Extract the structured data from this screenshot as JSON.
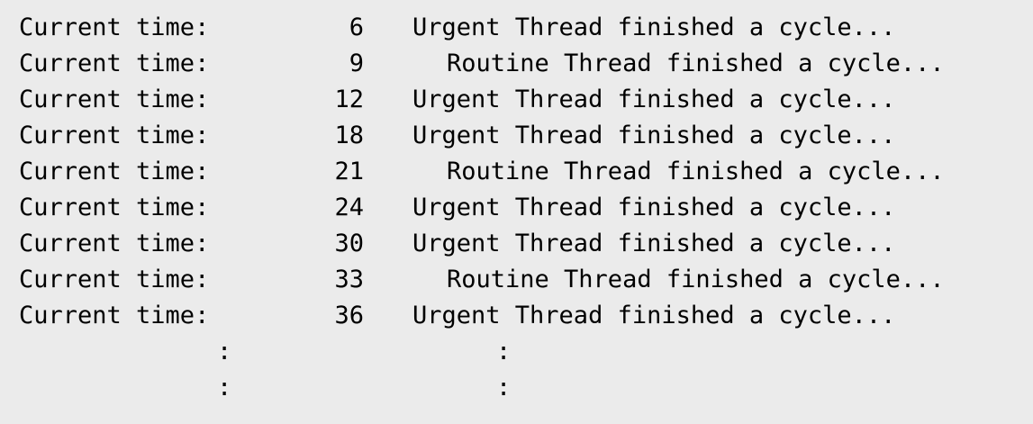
{
  "colors": {
    "background": "#ebebeb",
    "text": "#000000"
  },
  "lines": [
    {
      "label": "Current time:",
      "time": "6",
      "message": "Urgent Thread finished a cycle...",
      "kind": "urgent"
    },
    {
      "label": "Current time:",
      "time": "9",
      "message": "Routine Thread finished a cycle...",
      "kind": "routine"
    },
    {
      "label": "Current time:",
      "time": "12",
      "message": "Urgent Thread finished a cycle...",
      "kind": "urgent"
    },
    {
      "label": "Current time:",
      "time": "18",
      "message": "Urgent Thread finished a cycle...",
      "kind": "urgent"
    },
    {
      "label": "Current time:",
      "time": "21",
      "message": "Routine Thread finished a cycle...",
      "kind": "routine"
    },
    {
      "label": "Current time:",
      "time": "24",
      "message": "Urgent Thread finished a cycle...",
      "kind": "urgent"
    },
    {
      "label": "Current time:",
      "time": "30",
      "message": "Urgent Thread finished a cycle...",
      "kind": "urgent"
    },
    {
      "label": "Current time:",
      "time": "33",
      "message": "Routine Thread finished a cycle...",
      "kind": "routine"
    },
    {
      "label": "Current time:",
      "time": "36",
      "message": "Urgent Thread finished a cycle...",
      "kind": "urgent"
    }
  ],
  "continuation": {
    "mark_left": ":",
    "mark_right": ":"
  }
}
